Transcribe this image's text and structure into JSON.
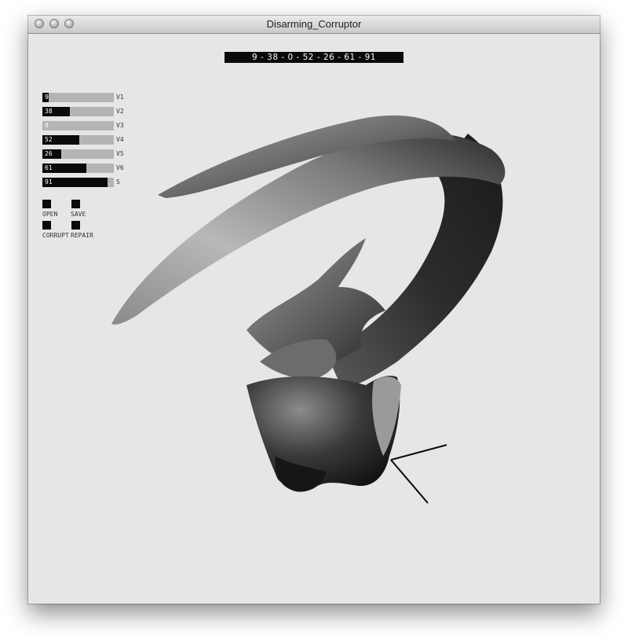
{
  "window": {
    "title": "Disarming_Corruptor"
  },
  "readout": "9 - 38 - 0 - 52 - 26 - 61 - 91",
  "sliders": [
    {
      "label": "V1",
      "value": "9",
      "fraction": 0.09
    },
    {
      "label": "V2",
      "value": "38",
      "fraction": 0.38
    },
    {
      "label": "V3",
      "value": "0",
      "fraction": 0.0
    },
    {
      "label": "V4",
      "value": "52",
      "fraction": 0.52
    },
    {
      "label": "V5",
      "value": "26",
      "fraction": 0.26
    },
    {
      "label": "V6",
      "value": "61",
      "fraction": 0.61
    },
    {
      "label": "S",
      "value": "91",
      "fraction": 0.91
    }
  ],
  "buttons": {
    "open": "OPEN",
    "save": "SAVE",
    "corrupt": "CORRUPT",
    "repair": "REPAIR"
  },
  "colors": {
    "background": "#e6e6e6",
    "accent": "#0a0a0a",
    "track": "#b4b4b4"
  }
}
